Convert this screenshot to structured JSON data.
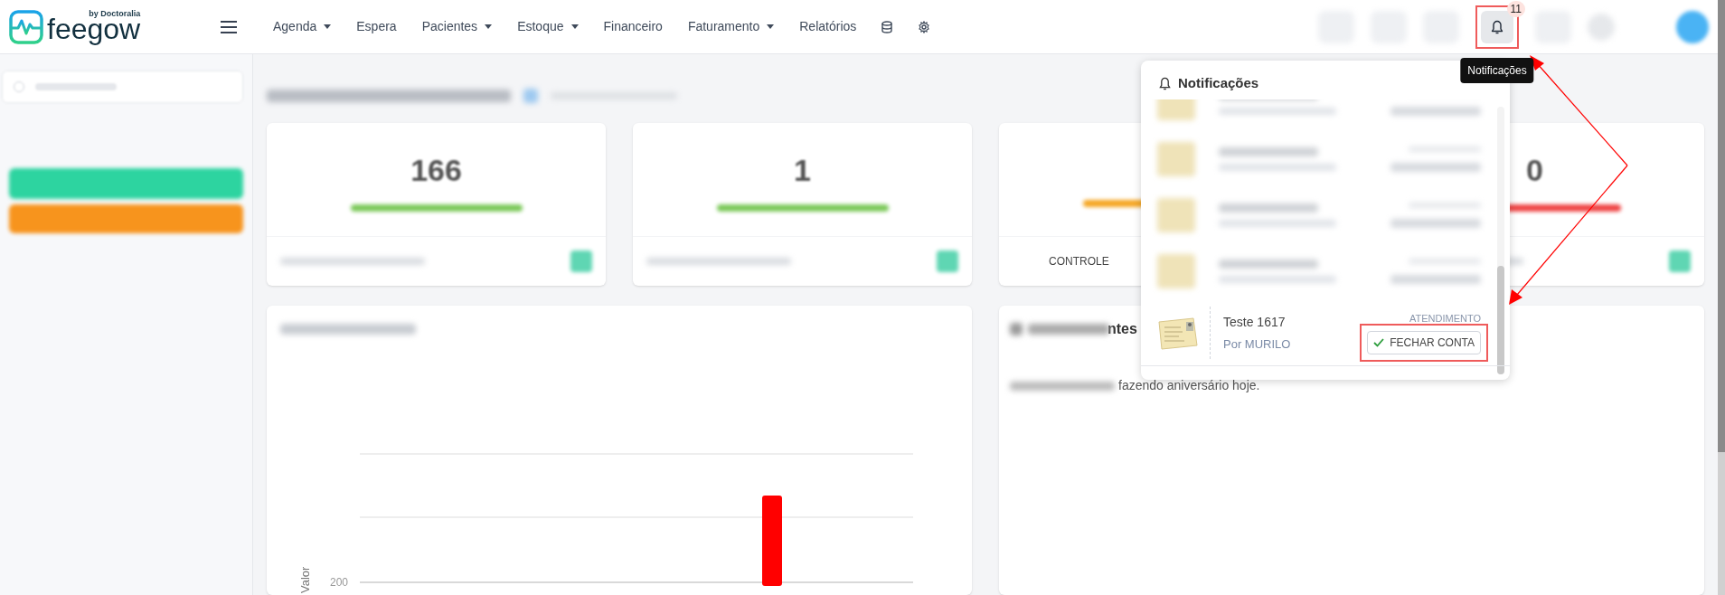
{
  "logo": {
    "brand": "feegow",
    "tagline": "by Doctoralia"
  },
  "nav": [
    {
      "label": "Agenda",
      "dropdown": true
    },
    {
      "label": "Espera",
      "dropdown": false
    },
    {
      "label": "Pacientes",
      "dropdown": true
    },
    {
      "label": "Estoque",
      "dropdown": true
    },
    {
      "label": "Financeiro",
      "dropdown": false
    },
    {
      "label": "Faturamento",
      "dropdown": true
    },
    {
      "label": "Relatórios",
      "dropdown": false
    }
  ],
  "notifications_button": {
    "badge": "11",
    "open": true,
    "highlighted": true,
    "tooltip": "Notificações"
  },
  "stat_cards": [
    {
      "value": "166",
      "color": "#7cc95a"
    },
    {
      "value": "1",
      "color": "#7cc95a"
    },
    {
      "footer": "CONTROLE",
      "color": "#f5a623"
    },
    {
      "value": "0",
      "color": "#ef4444"
    }
  ],
  "chart": {
    "axis_label": "Valor",
    "tick": "200"
  },
  "birthdays": {
    "title_fragment": "ntes",
    "message_fragment": "fazendo aniversário hoje."
  },
  "notifications_panel": {
    "title": "Notificações",
    "items": [
      {
        "kind": "blurred"
      },
      {
        "kind": "blurred"
      },
      {
        "kind": "blurred"
      },
      {
        "kind": "blurred"
      },
      {
        "kind": "notification",
        "title": "Teste 1617",
        "author": "Por MURILO",
        "category": "ATENDIMENTO",
        "action": "FECHAR CONTA",
        "highlighted": true
      }
    ]
  }
}
